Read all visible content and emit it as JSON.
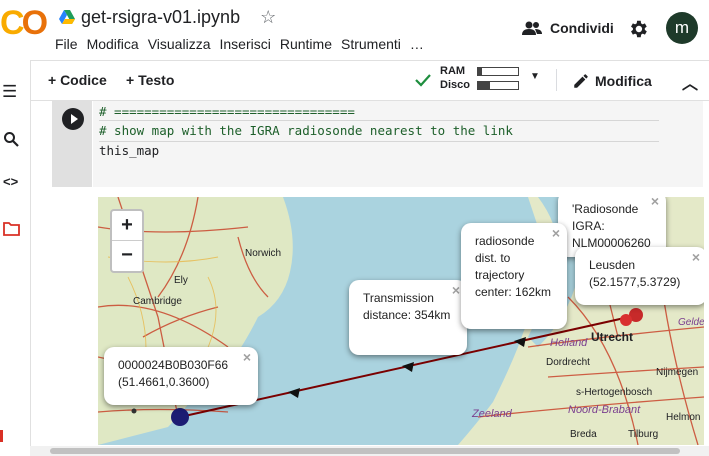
{
  "app": {
    "notebook_title": "get-rsigra-v01.ipynb",
    "avatar_letter": "m"
  },
  "menu": [
    "File",
    "Modifica",
    "Visualizza",
    "Inserisci",
    "Runtime",
    "Strumenti",
    "…"
  ],
  "share_label": "Condividi",
  "toolbar": {
    "code_label": "+ Codice",
    "text_label": "+ Testo",
    "ram_label": "RAM",
    "disk_label": "Disco",
    "edit_label": "Modifica",
    "ram_usage": 0.1,
    "disk_usage": 0.3
  },
  "cell": {
    "lines": [
      "# ================================",
      "# show map with the IGRA radiosonde nearest to the link",
      "this_map"
    ]
  },
  "map": {
    "place_labels": [
      "Norwich",
      "Ely",
      "Cambridge",
      "Utrecht",
      "Dordrecht",
      "Nijmegen",
      "Zeeland",
      "Noord-Brabant",
      "Holland",
      "s-Hertogenbosch",
      "Gelder",
      "Helmon",
      "Tilburg",
      "Breda"
    ],
    "popups": {
      "start": "0000024B0B030F66 (51.4661,0.3600)",
      "transmission": "Transmission distance: 354km",
      "radiosonde_dist": "radiosonde dist. to trajectory center: 162km",
      "radiosonde_igra": "'Radiosonde IGRA: NLM00006260",
      "leusden": "Leusden (52.1577,5.3729)"
    },
    "zoom_in": "+",
    "zoom_out": "−"
  }
}
